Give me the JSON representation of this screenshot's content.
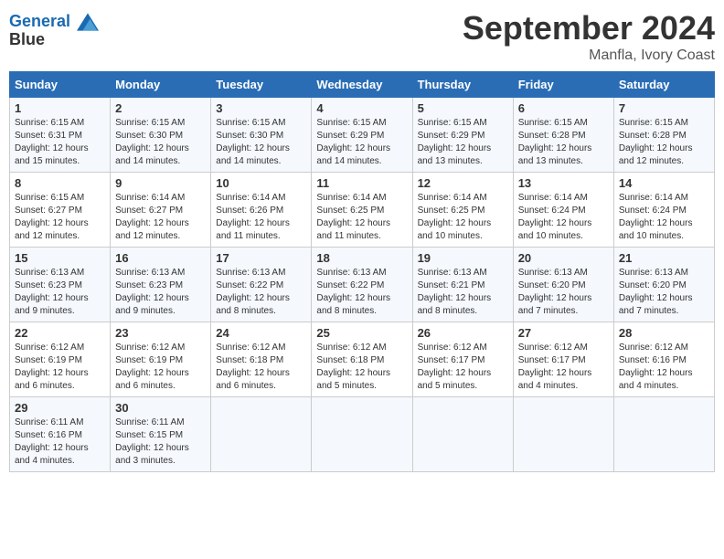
{
  "header": {
    "logo_line1": "General",
    "logo_line2": "Blue",
    "month_title": "September 2024",
    "subtitle": "Manfla, Ivory Coast"
  },
  "days_of_week": [
    "Sunday",
    "Monday",
    "Tuesday",
    "Wednesday",
    "Thursday",
    "Friday",
    "Saturday"
  ],
  "weeks": [
    [
      {
        "day": "1",
        "sunrise": "6:15 AM",
        "sunset": "6:31 PM",
        "daylight": "12 hours and 15 minutes."
      },
      {
        "day": "2",
        "sunrise": "6:15 AM",
        "sunset": "6:30 PM",
        "daylight": "12 hours and 14 minutes."
      },
      {
        "day": "3",
        "sunrise": "6:15 AM",
        "sunset": "6:30 PM",
        "daylight": "12 hours and 14 minutes."
      },
      {
        "day": "4",
        "sunrise": "6:15 AM",
        "sunset": "6:29 PM",
        "daylight": "12 hours and 14 minutes."
      },
      {
        "day": "5",
        "sunrise": "6:15 AM",
        "sunset": "6:29 PM",
        "daylight": "12 hours and 13 minutes."
      },
      {
        "day": "6",
        "sunrise": "6:15 AM",
        "sunset": "6:28 PM",
        "daylight": "12 hours and 13 minutes."
      },
      {
        "day": "7",
        "sunrise": "6:15 AM",
        "sunset": "6:28 PM",
        "daylight": "12 hours and 12 minutes."
      }
    ],
    [
      {
        "day": "8",
        "sunrise": "6:15 AM",
        "sunset": "6:27 PM",
        "daylight": "12 hours and 12 minutes."
      },
      {
        "day": "9",
        "sunrise": "6:14 AM",
        "sunset": "6:27 PM",
        "daylight": "12 hours and 12 minutes."
      },
      {
        "day": "10",
        "sunrise": "6:14 AM",
        "sunset": "6:26 PM",
        "daylight": "12 hours and 11 minutes."
      },
      {
        "day": "11",
        "sunrise": "6:14 AM",
        "sunset": "6:25 PM",
        "daylight": "12 hours and 11 minutes."
      },
      {
        "day": "12",
        "sunrise": "6:14 AM",
        "sunset": "6:25 PM",
        "daylight": "12 hours and 10 minutes."
      },
      {
        "day": "13",
        "sunrise": "6:14 AM",
        "sunset": "6:24 PM",
        "daylight": "12 hours and 10 minutes."
      },
      {
        "day": "14",
        "sunrise": "6:14 AM",
        "sunset": "6:24 PM",
        "daylight": "12 hours and 10 minutes."
      }
    ],
    [
      {
        "day": "15",
        "sunrise": "6:13 AM",
        "sunset": "6:23 PM",
        "daylight": "12 hours and 9 minutes."
      },
      {
        "day": "16",
        "sunrise": "6:13 AM",
        "sunset": "6:23 PM",
        "daylight": "12 hours and 9 minutes."
      },
      {
        "day": "17",
        "sunrise": "6:13 AM",
        "sunset": "6:22 PM",
        "daylight": "12 hours and 8 minutes."
      },
      {
        "day": "18",
        "sunrise": "6:13 AM",
        "sunset": "6:22 PM",
        "daylight": "12 hours and 8 minutes."
      },
      {
        "day": "19",
        "sunrise": "6:13 AM",
        "sunset": "6:21 PM",
        "daylight": "12 hours and 8 minutes."
      },
      {
        "day": "20",
        "sunrise": "6:13 AM",
        "sunset": "6:20 PM",
        "daylight": "12 hours and 7 minutes."
      },
      {
        "day": "21",
        "sunrise": "6:13 AM",
        "sunset": "6:20 PM",
        "daylight": "12 hours and 7 minutes."
      }
    ],
    [
      {
        "day": "22",
        "sunrise": "6:12 AM",
        "sunset": "6:19 PM",
        "daylight": "12 hours and 6 minutes."
      },
      {
        "day": "23",
        "sunrise": "6:12 AM",
        "sunset": "6:19 PM",
        "daylight": "12 hours and 6 minutes."
      },
      {
        "day": "24",
        "sunrise": "6:12 AM",
        "sunset": "6:18 PM",
        "daylight": "12 hours and 6 minutes."
      },
      {
        "day": "25",
        "sunrise": "6:12 AM",
        "sunset": "6:18 PM",
        "daylight": "12 hours and 5 minutes."
      },
      {
        "day": "26",
        "sunrise": "6:12 AM",
        "sunset": "6:17 PM",
        "daylight": "12 hours and 5 minutes."
      },
      {
        "day": "27",
        "sunrise": "6:12 AM",
        "sunset": "6:17 PM",
        "daylight": "12 hours and 4 minutes."
      },
      {
        "day": "28",
        "sunrise": "6:12 AM",
        "sunset": "6:16 PM",
        "daylight": "12 hours and 4 minutes."
      }
    ],
    [
      {
        "day": "29",
        "sunrise": "6:11 AM",
        "sunset": "6:16 PM",
        "daylight": "12 hours and 4 minutes."
      },
      {
        "day": "30",
        "sunrise": "6:11 AM",
        "sunset": "6:15 PM",
        "daylight": "12 hours and 3 minutes."
      },
      null,
      null,
      null,
      null,
      null
    ]
  ]
}
